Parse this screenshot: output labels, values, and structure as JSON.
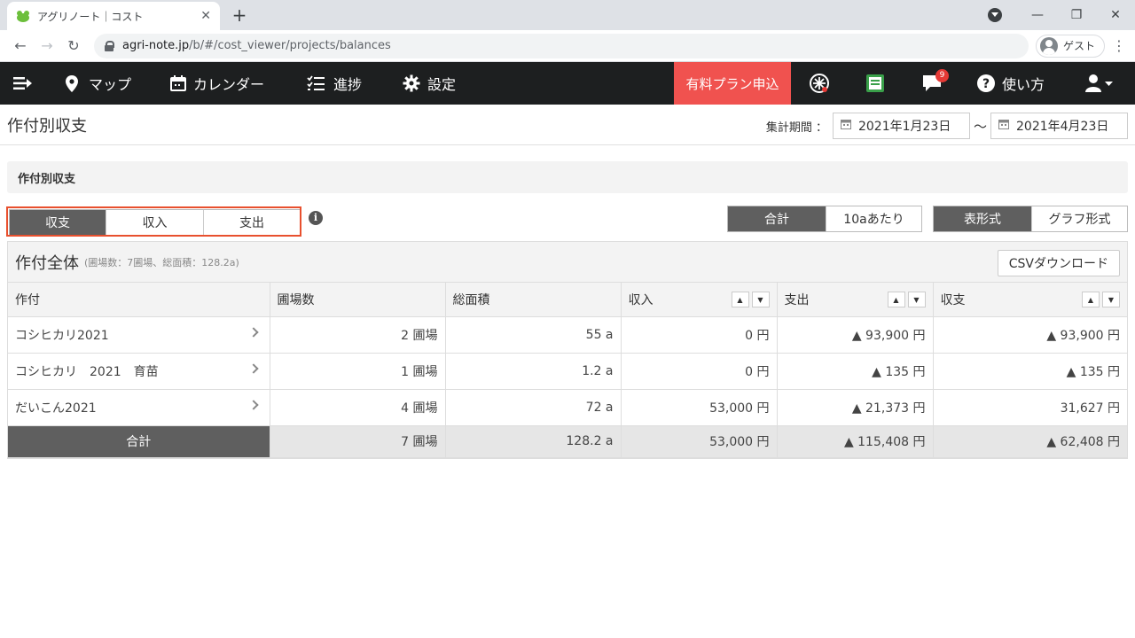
{
  "browser": {
    "tab_title": "アグリノート｜コスト",
    "url_host": "agri-note.jp",
    "url_path": "/b/#/cost_viewer/projects/balances",
    "profile_label": "ゲスト"
  },
  "appnav": {
    "map": "マップ",
    "calendar": "カレンダー",
    "progress": "進捗",
    "settings": "設定",
    "plan": "有料プラン申込",
    "notification_count": "9",
    "help": "使い方"
  },
  "page": {
    "title": "作付別収支",
    "period_label": "集計期間 ：",
    "date_from": "2021年1月23日",
    "date_sep": "～",
    "date_to": "2021年4月23日",
    "section_title": "作付別収支"
  },
  "modes": {
    "tabs": [
      "収支",
      "収入",
      "支出"
    ],
    "active": 0
  },
  "units": {
    "tabs": [
      "合計",
      "10aあたり"
    ],
    "active": 0
  },
  "views": {
    "tabs": [
      "表形式",
      "グラフ形式"
    ],
    "active": 0
  },
  "panel": {
    "title": "作付全体",
    "subtitle": "(圃場数：7圃場、総面積：128.2a)",
    "csv": "CSVダウンロード"
  },
  "table": {
    "headers": [
      "作付",
      "圃場数",
      "総面積",
      "収入",
      "支出",
      "収支"
    ],
    "rows": [
      [
        "コシヒカリ2021",
        "2 圃場",
        "55 a",
        "0 円",
        "▲ 93,900 円",
        "▲ 93,900 円"
      ],
      [
        "コシヒカリ　2021　育苗",
        "1 圃場",
        "1.2 a",
        "0 円",
        "▲ 135 円",
        "▲ 135 円"
      ],
      [
        "だいこん2021",
        "4 圃場",
        "72 a",
        "53,000 円",
        "▲ 21,373 円",
        "31,627 円"
      ]
    ],
    "total": [
      "合計",
      "7 圃場",
      "128.2 a",
      "53,000 円",
      "▲ 115,408 円",
      "▲ 62,408 円"
    ]
  }
}
